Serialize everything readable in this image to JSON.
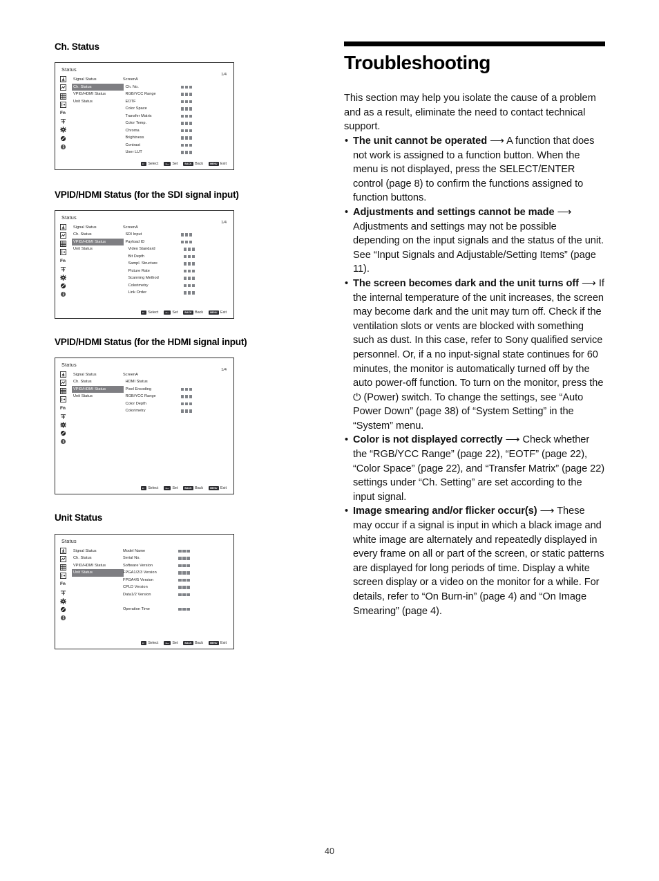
{
  "page": {
    "number": "40"
  },
  "osd_common": {
    "title": "Status",
    "page_indicator": "1/4",
    "menu": [
      "Signal Status",
      "Ch. Status",
      "VPID/HDMI Status",
      "Unit Status"
    ],
    "rail_icons": [
      "signal-input-icon",
      "waveform-icon",
      "grid-icon",
      "input-select-icon",
      "fn-icon",
      "marker-icon",
      "gear-icon",
      "prohibited-icon",
      "info-icon"
    ],
    "rail_fn_label": "Fn",
    "footer": [
      {
        "badge": "●↕",
        "label": "Select"
      },
      {
        "badge": "●—",
        "label": "Set"
      },
      {
        "badge": "BACK",
        "label": "Back"
      },
      {
        "badge": "MENU",
        "label": "Exit"
      }
    ],
    "block_color": "#808388",
    "highlight_color": "#7e7e82"
  },
  "sections": [
    {
      "heading": "Ch. Status",
      "selected_menu_index": 1,
      "show_page_indicator": true,
      "rows": [
        {
          "label": "ScreenA",
          "indent": 0,
          "blocks": false
        },
        {
          "label": "Ch. No.",
          "indent": 1,
          "blocks": true
        },
        {
          "label": "RGB/YCC Range",
          "indent": 1,
          "blocks": true
        },
        {
          "label": "EOTF",
          "indent": 1,
          "blocks": true
        },
        {
          "label": "Color Space",
          "indent": 1,
          "blocks": true
        },
        {
          "label": "Transfer Matrix",
          "indent": 1,
          "blocks": true
        },
        {
          "label": "Color Temp.",
          "indent": 1,
          "blocks": true
        },
        {
          "label": "Chroma",
          "indent": 1,
          "blocks": true
        },
        {
          "label": "Brightness",
          "indent": 1,
          "blocks": true
        },
        {
          "label": "Contrast",
          "indent": 1,
          "blocks": true
        },
        {
          "label": "User LUT",
          "indent": 1,
          "blocks": true
        }
      ]
    },
    {
      "heading": "VPID/HDMI Status (for the SDI signal input)",
      "selected_menu_index": 2,
      "show_page_indicator": true,
      "rows": [
        {
          "label": "ScreenA",
          "indent": 0,
          "blocks": false
        },
        {
          "label": "SDI Input",
          "indent": 1,
          "blocks": true
        },
        {
          "label": "Payload ID",
          "indent": 1,
          "blocks": true
        },
        {
          "label": "Video Standard",
          "indent": 2,
          "blocks": true
        },
        {
          "label": "Bit Depth",
          "indent": 2,
          "blocks": true
        },
        {
          "label": "Sampl. Structure",
          "indent": 2,
          "blocks": true
        },
        {
          "label": "Picture Rate",
          "indent": 2,
          "blocks": true
        },
        {
          "label": "Scanning Method",
          "indent": 2,
          "blocks": true
        },
        {
          "label": "Colorimetry",
          "indent": 2,
          "blocks": true
        },
        {
          "label": "Link Order",
          "indent": 2,
          "blocks": true
        }
      ]
    },
    {
      "heading": "VPID/HDMI Status (for the HDMI signal input)",
      "selected_menu_index": 2,
      "show_page_indicator": true,
      "rows": [
        {
          "label": "ScreenA",
          "indent": 0,
          "blocks": false
        },
        {
          "label": "HDMI Status",
          "indent": 1,
          "blocks": false
        },
        {
          "label": "Pixel Encoding",
          "indent": 1,
          "blocks": true
        },
        {
          "label": "RGB/YCC Range",
          "indent": 1,
          "blocks": true
        },
        {
          "label": "Color Depth",
          "indent": 1,
          "blocks": true
        },
        {
          "label": "Colorimetry",
          "indent": 1,
          "blocks": true
        }
      ]
    },
    {
      "heading": "Unit Status",
      "selected_menu_index": 3,
      "show_page_indicator": false,
      "rows": [
        {
          "label": "Model Name",
          "indent": 0,
          "blocks": true
        },
        {
          "label": "Serial No.",
          "indent": 0,
          "blocks": true
        },
        {
          "label": "Software Version",
          "indent": 0,
          "blocks": true
        },
        {
          "label": "FPGA1/2/3 Version",
          "indent": 0,
          "blocks": true
        },
        {
          "label": "FPGA4/5 Version",
          "indent": 0,
          "blocks": true
        },
        {
          "label": "CPLD Version",
          "indent": 0,
          "blocks": true
        },
        {
          "label": "Data1/2 Version",
          "indent": 0,
          "blocks": true
        },
        {
          "label": "",
          "indent": 0,
          "blocks": false
        },
        {
          "label": "Operation Time",
          "indent": 0,
          "blocks": true
        }
      ]
    }
  ],
  "troubleshooting": {
    "title": "Troubleshooting",
    "intro": "This section may help you isolate the cause of a problem and as a result, eliminate the need to contact technical support.",
    "items": [
      {
        "term": "The unit cannot be operated",
        "arrow": "⟶",
        "body": " A function that does not work is assigned to a function button. When the menu is not displayed, press the SELECT/ENTER control (page 8) to confirm the functions assigned to function buttons."
      },
      {
        "term": "Adjustments and settings cannot be made",
        "arrow": "⟶",
        "body": " Adjustments and settings may not be possible depending on the input signals and the status of the unit. See “Input Signals and Adjustable/Setting Items” (page 11)."
      },
      {
        "term": "The screen becomes dark and the unit turns off",
        "arrow": "⟶",
        "body": " If the internal temperature of the unit increases, the screen may become dark and the unit may turn off. Check if the ventilation slots or vents are blocked with something such as dust. In this case, refer to Sony qualified service personnel. Or, if a no input-signal state continues for 60 minutes, the monitor is automatically turned off by the auto power-off function. To turn on the monitor, press the ⏻ (Power) switch. To change the settings, see “Auto Power Down” (page 38) of “System Setting” in the “System” menu."
      },
      {
        "term": "Color is not displayed correctly",
        "arrow": "⟶",
        "body": " Check whether the “RGB/YCC Range” (page 22), “EOTF” (page 22), “Color Space” (page 22), and “Transfer Matrix” (page 22) settings under “Ch. Setting” are set according to the input signal."
      },
      {
        "term": "Image smearing and/or flicker occur(s)",
        "arrow": "⟶",
        "body": " These may occur if a signal is input in which a black image and white image are alternately and repeatedly displayed in every frame on all or part of the screen, or static patterns are displayed for long periods of time. Display a white screen display or a video on the monitor for a while. For details, refer to “On Burn-in” (page 4) and “On Image Smearing” (page 4)."
      }
    ]
  }
}
